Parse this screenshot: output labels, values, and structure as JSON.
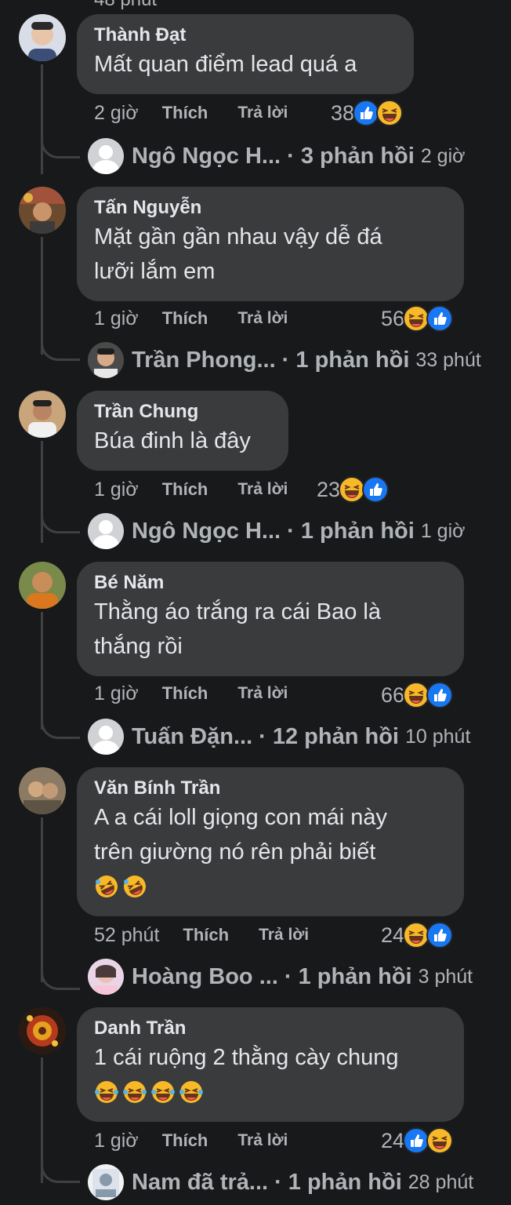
{
  "top_fragment": "48 phút",
  "labels": {
    "like": "Thích",
    "reply": "Trả lời"
  },
  "comments": [
    {
      "author": "Thành Đạt",
      "lines": [
        "Mất quan điểm lead quá a"
      ],
      "time": "2 giờ",
      "reaction_count": "38",
      "reactions": [
        "like-icon",
        "haha-icon"
      ],
      "reply_name": "Ngô Ngọc H...",
      "reply_count": "· 3 phản hồi",
      "reply_time": "2 giờ"
    },
    {
      "author": "Tấn Nguyễn",
      "lines": [
        "Mặt gần gần nhau vậy dễ đá",
        "lưỡi lắm em"
      ],
      "time": "1 giờ",
      "reaction_count": "56",
      "reactions": [
        "haha-icon",
        "like-icon"
      ],
      "reply_name": "Trần Phong...",
      "reply_count": "· 1 phản hồi",
      "reply_time": "33 phút"
    },
    {
      "author": "Trần Chung",
      "lines": [
        "Búa đinh là đây"
      ],
      "time": "1 giờ",
      "reaction_count": "23",
      "reactions": [
        "haha-icon",
        "like-icon"
      ],
      "reply_name": "Ngô Ngọc H...",
      "reply_count": "· 1 phản hồi",
      "reply_time": "1 giờ"
    },
    {
      "author": "Bé Năm",
      "lines": [
        "Thằng áo trắng ra cái Bao là",
        "thắng rồi"
      ],
      "time": "1 giờ",
      "reaction_count": "66",
      "reactions": [
        "haha-icon",
        "like-icon"
      ],
      "reply_name": "Tuấn Đặn...",
      "reply_count": "· 12 phản hồi",
      "reply_time": "10 phút"
    },
    {
      "author": "Văn Bính Trần",
      "lines": [
        "A a cái loll giọng con mái này",
        "trên giường nó rên phải biết"
      ],
      "emojis": [
        "rofl-emoji",
        "rofl-emoji"
      ],
      "time": "52 phút",
      "reaction_count": "24",
      "reactions": [
        "haha-icon",
        "like-icon"
      ],
      "reply_name": "Hoàng Boo ...",
      "reply_count": "· 1 phản hồi",
      "reply_time": "3 phút"
    },
    {
      "author": "Danh Trần",
      "lines": [
        "1 cái ruộng 2 thằng cày chung"
      ],
      "emojis": [
        "joy-emoji",
        "joy-emoji",
        "joy-emoji",
        "joy-emoji"
      ],
      "time": "1 giờ",
      "reaction_count": "24",
      "reactions": [
        "like-icon",
        "haha-icon"
      ],
      "reply_name": "Nam đã trả...",
      "reply_count": "· 1 phản hồi",
      "reply_time": "28 phút"
    }
  ],
  "colors": {
    "background": "#18191a",
    "bubble": "#3a3b3c",
    "text_primary": "#e4e6eb",
    "text_secondary": "#b0b3b8",
    "like_blue": "#1877f2",
    "haha_yellow": "#f7b928"
  }
}
